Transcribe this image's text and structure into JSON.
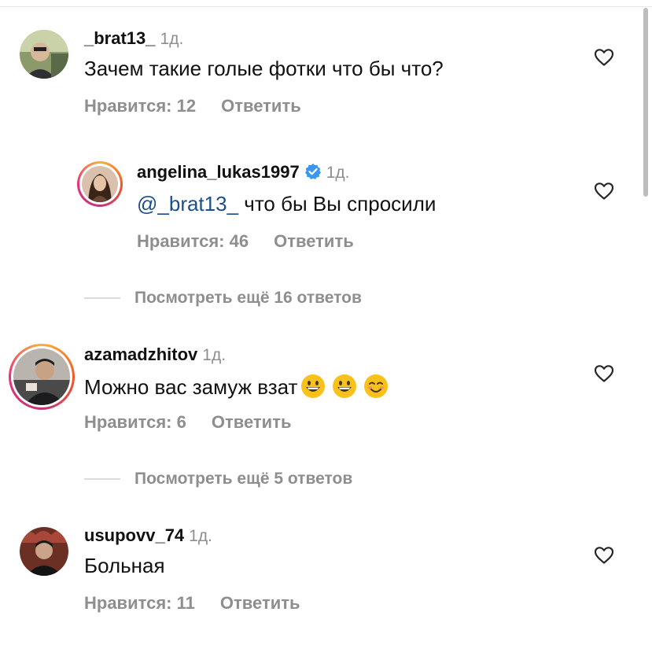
{
  "comments": [
    {
      "username": "_brat13_",
      "time": "1д.",
      "text": "Зачем такие голые фотки что бы что?",
      "likes": "Нравится: 12",
      "reply": "Ответить"
    },
    {
      "username": "angelina_lukas1997",
      "time": "1д.",
      "mention": "@_brat13_",
      "text": " что бы Вы спросили",
      "likes": "Нравится: 46",
      "reply": "Ответить"
    },
    {
      "username": "azamadzhitov",
      "time": "1д.",
      "text": "Можно вас замуж взат",
      "likes": "Нравится: 6",
      "reply": "Ответить"
    },
    {
      "username": "usupovv_74",
      "time": "1д.",
      "text": "Больная",
      "likes": "Нравится: 11",
      "reply": "Ответить"
    }
  ],
  "more_replies": [
    "Посмотреть ещё 16 ответов",
    "Посмотреть ещё 5 ответов"
  ],
  "colors": {
    "muted": "#8e8e8e",
    "mention": "#1c4f8a",
    "verified": "#3897f0"
  }
}
